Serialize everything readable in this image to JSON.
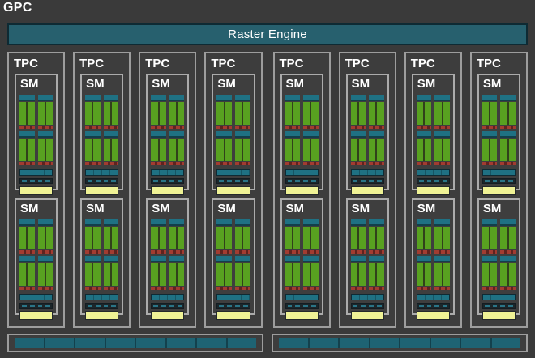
{
  "diagram": {
    "title": "GPC",
    "raster_engine_label": "Raster Engine",
    "tpc_count": 8,
    "sms_per_tpc": 2,
    "processing_blocks_per_sm": 2,
    "core_strips_per_subblock": 2,
    "subblocks_per_processing_row": 2,
    "ldst_units_per_sm": 4,
    "bottom_bar_count": 2,
    "segments_per_bottom_bar": 8
  },
  "colors": {
    "background": "#3a3a3a",
    "panel": "#3d3d3d",
    "border_light": "#9d9d9d",
    "teal": "#27606e",
    "teal_bright": "#1f7183",
    "teal_strip": "#1e6373",
    "green": "#58a120",
    "green_divider": "#31411b",
    "red": "#a23c31",
    "red_dark": "#5f231f",
    "yellow": "#eff295",
    "text": "#ffffff"
  },
  "tpcs": [
    {
      "label": "TPC",
      "sms": [
        {
          "label": "SM"
        },
        {
          "label": "SM"
        }
      ]
    },
    {
      "label": "TPC",
      "sms": [
        {
          "label": "SM"
        },
        {
          "label": "SM"
        }
      ]
    },
    {
      "label": "TPC",
      "sms": [
        {
          "label": "SM"
        },
        {
          "label": "SM"
        }
      ]
    },
    {
      "label": "TPC",
      "sms": [
        {
          "label": "SM"
        },
        {
          "label": "SM"
        }
      ]
    },
    {
      "label": "TPC",
      "sms": [
        {
          "label": "SM"
        },
        {
          "label": "SM"
        }
      ]
    },
    {
      "label": "TPC",
      "sms": [
        {
          "label": "SM"
        },
        {
          "label": "SM"
        }
      ]
    },
    {
      "label": "TPC",
      "sms": [
        {
          "label": "SM"
        },
        {
          "label": "SM"
        }
      ]
    },
    {
      "label": "TPC",
      "sms": [
        {
          "label": "SM"
        },
        {
          "label": "SM"
        }
      ]
    }
  ]
}
